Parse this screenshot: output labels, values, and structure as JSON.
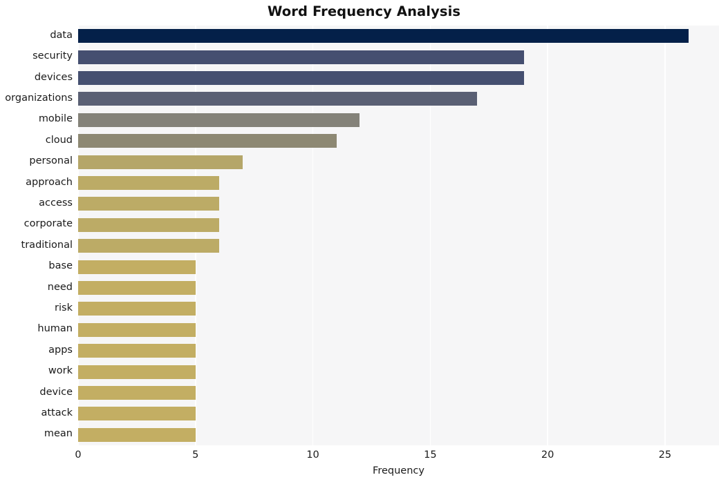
{
  "chart_data": {
    "type": "bar",
    "orientation": "horizontal",
    "title": "Word Frequency Analysis",
    "xlabel": "Frequency",
    "ylabel": "",
    "xlim": [
      0,
      27.3
    ],
    "ylim": null,
    "grid": true,
    "legend": null,
    "xticks": [
      0,
      5,
      10,
      15,
      20,
      25
    ],
    "xtick_labels": [
      "0",
      "5",
      "10",
      "15",
      "20",
      "25"
    ],
    "categories": [
      "data",
      "security",
      "devices",
      "organizations",
      "mobile",
      "cloud",
      "personal",
      "approach",
      "access",
      "corporate",
      "traditional",
      "base",
      "need",
      "risk",
      "human",
      "apps",
      "work",
      "device",
      "attack",
      "mean"
    ],
    "values": [
      26,
      19,
      19,
      17,
      12,
      11,
      7,
      6,
      6,
      6,
      6,
      5,
      5,
      5,
      5,
      5,
      5,
      5,
      5,
      5
    ],
    "bar_colors": [
      "#042049",
      "#454f70",
      "#454f70",
      "#5a6074",
      "#848279",
      "#8d8873",
      "#b5a669",
      "#bcab66",
      "#bcab66",
      "#bcab66",
      "#bcab66",
      "#c3ae63",
      "#c3ae63",
      "#c3ae63",
      "#c3ae63",
      "#c3ae63",
      "#c3ae63",
      "#c3ae63",
      "#c3ae63",
      "#c3ae63"
    ],
    "plot_background": "#f6f6f7",
    "grid_color": "#ffffff",
    "figure_background": "#ffffff",
    "text_color": "#1a1a1a"
  }
}
